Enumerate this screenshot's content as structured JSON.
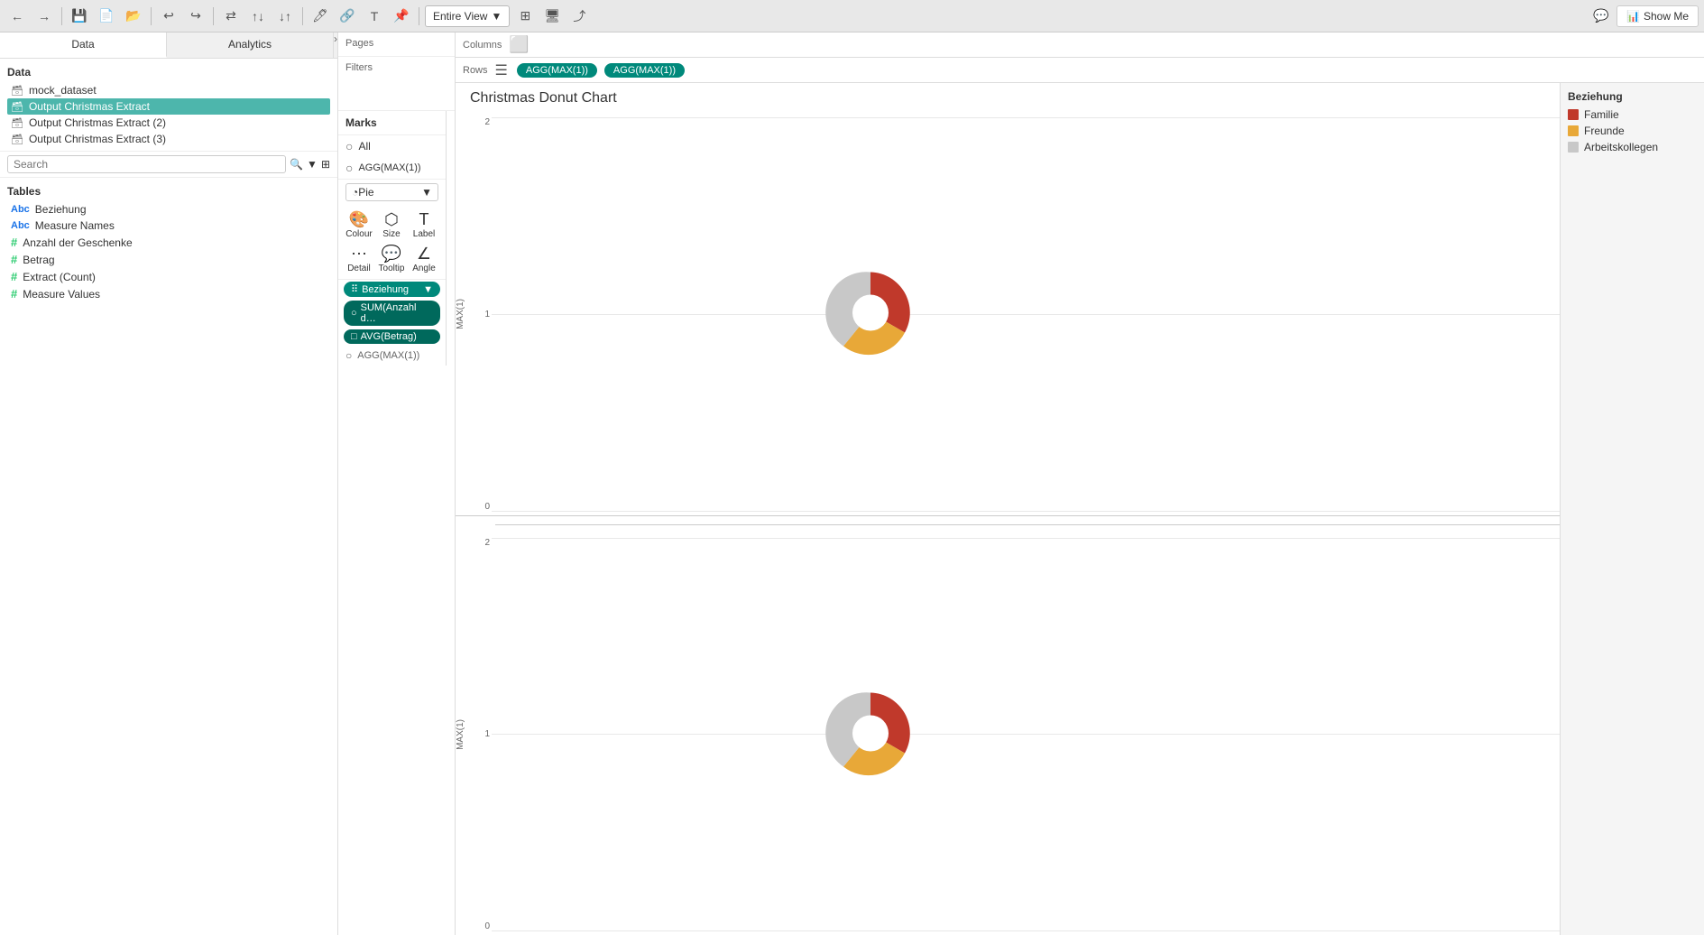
{
  "toolbar": {
    "view_dropdown": "Entire View",
    "show_me_label": "Show Me"
  },
  "sidebar": {
    "data_tab": "Data",
    "analytics_tab": "Analytics",
    "data_section_title": "Data",
    "datasets": [
      {
        "id": "mock_dataset",
        "label": "mock_dataset",
        "icon": "table"
      },
      {
        "id": "output_christmas",
        "label": "Output Christmas Extract",
        "icon": "table",
        "active": true
      },
      {
        "id": "output_christmas_2",
        "label": "Output Christmas Extract (2)",
        "icon": "table"
      },
      {
        "id": "output_christmas_3",
        "label": "Output Christmas Extract (3)",
        "icon": "table"
      }
    ],
    "search_placeholder": "Search",
    "tables_title": "Tables",
    "fields": [
      {
        "id": "beziehung",
        "label": "Beziehung",
        "type": "abc"
      },
      {
        "id": "measure_names",
        "label": "Measure Names",
        "type": "abc"
      },
      {
        "id": "anzahl",
        "label": "Anzahl der Geschenke",
        "type": "hash"
      },
      {
        "id": "betrag",
        "label": "Betrag",
        "type": "hash"
      },
      {
        "id": "extract_count",
        "label": "Extract (Count)",
        "type": "hash"
      },
      {
        "id": "measure_values",
        "label": "Measure Values",
        "type": "hash"
      }
    ]
  },
  "pages_title": "Pages",
  "filters_title": "Filters",
  "marks": {
    "title": "Marks",
    "all_label": "All",
    "agg_label": "AGG(MAX(1))",
    "type": "Pie",
    "properties": [
      {
        "id": "colour",
        "label": "Colour",
        "icon": "⬛"
      },
      {
        "id": "size",
        "label": "Size",
        "icon": "⬡"
      },
      {
        "id": "label",
        "label": "Label",
        "icon": "T"
      },
      {
        "id": "detail",
        "label": "Detail",
        "icon": "⋯"
      },
      {
        "id": "tooltip",
        "label": "Tooltip",
        "icon": "💬"
      },
      {
        "id": "angle",
        "label": "Angle",
        "icon": "∠"
      }
    ],
    "pills": [
      {
        "id": "beziehung_pill",
        "label": "Beziehung",
        "icon": "dots"
      },
      {
        "id": "sum_anzahl_pill",
        "label": "SUM(Anzahl d…",
        "icon": "circle"
      },
      {
        "id": "avg_betrag_pill",
        "label": "AVG(Betrag)",
        "icon": "speech"
      }
    ],
    "agg2_label": "AGG(MAX(1))"
  },
  "columns_label": "Columns",
  "rows_label": "Rows",
  "rows_pills": [
    "AGG(MAX(1))",
    "AGG(MAX(1))"
  ],
  "chart": {
    "title": "Christmas Donut Chart",
    "top_pane_axis_label": "MAX(1)",
    "bottom_pane_axis_label": "MAX(1)",
    "top_ticks": [
      "2",
      "1",
      "0"
    ],
    "bottom_ticks": [
      "2",
      "1",
      "0"
    ]
  },
  "legend": {
    "title": "Beziehung",
    "items": [
      {
        "id": "familie",
        "label": "Familie",
        "color": "#c0392b"
      },
      {
        "id": "freunde",
        "label": "Freunde",
        "color": "#e8a838"
      },
      {
        "id": "arbeitskollegen",
        "label": "Arbeitskollegen",
        "color": "#c8c8c8"
      }
    ]
  }
}
